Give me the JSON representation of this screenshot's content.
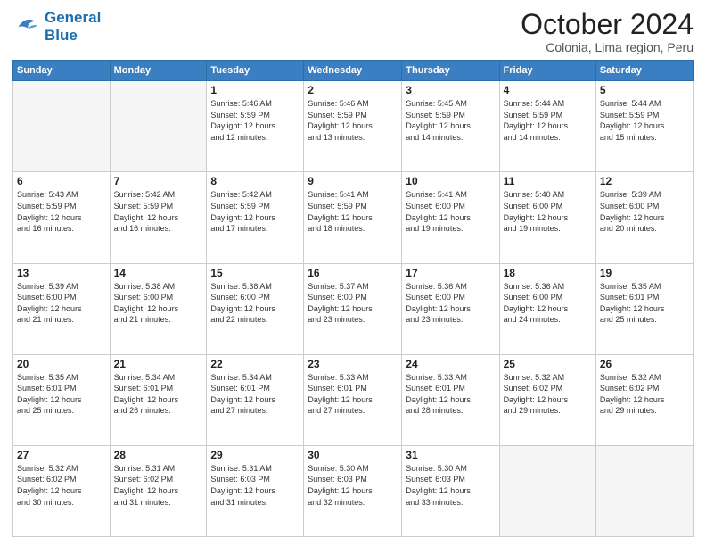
{
  "logo": {
    "line1": "General",
    "line2": "Blue"
  },
  "header": {
    "month": "October 2024",
    "location": "Colonia, Lima region, Peru"
  },
  "weekdays": [
    "Sunday",
    "Monday",
    "Tuesday",
    "Wednesday",
    "Thursday",
    "Friday",
    "Saturday"
  ],
  "weeks": [
    [
      {
        "day": "",
        "info": ""
      },
      {
        "day": "",
        "info": ""
      },
      {
        "day": "1",
        "info": "Sunrise: 5:46 AM\nSunset: 5:59 PM\nDaylight: 12 hours\nand 12 minutes."
      },
      {
        "day": "2",
        "info": "Sunrise: 5:46 AM\nSunset: 5:59 PM\nDaylight: 12 hours\nand 13 minutes."
      },
      {
        "day": "3",
        "info": "Sunrise: 5:45 AM\nSunset: 5:59 PM\nDaylight: 12 hours\nand 14 minutes."
      },
      {
        "day": "4",
        "info": "Sunrise: 5:44 AM\nSunset: 5:59 PM\nDaylight: 12 hours\nand 14 minutes."
      },
      {
        "day": "5",
        "info": "Sunrise: 5:44 AM\nSunset: 5:59 PM\nDaylight: 12 hours\nand 15 minutes."
      }
    ],
    [
      {
        "day": "6",
        "info": "Sunrise: 5:43 AM\nSunset: 5:59 PM\nDaylight: 12 hours\nand 16 minutes."
      },
      {
        "day": "7",
        "info": "Sunrise: 5:42 AM\nSunset: 5:59 PM\nDaylight: 12 hours\nand 16 minutes."
      },
      {
        "day": "8",
        "info": "Sunrise: 5:42 AM\nSunset: 5:59 PM\nDaylight: 12 hours\nand 17 minutes."
      },
      {
        "day": "9",
        "info": "Sunrise: 5:41 AM\nSunset: 5:59 PM\nDaylight: 12 hours\nand 18 minutes."
      },
      {
        "day": "10",
        "info": "Sunrise: 5:41 AM\nSunset: 6:00 PM\nDaylight: 12 hours\nand 19 minutes."
      },
      {
        "day": "11",
        "info": "Sunrise: 5:40 AM\nSunset: 6:00 PM\nDaylight: 12 hours\nand 19 minutes."
      },
      {
        "day": "12",
        "info": "Sunrise: 5:39 AM\nSunset: 6:00 PM\nDaylight: 12 hours\nand 20 minutes."
      }
    ],
    [
      {
        "day": "13",
        "info": "Sunrise: 5:39 AM\nSunset: 6:00 PM\nDaylight: 12 hours\nand 21 minutes."
      },
      {
        "day": "14",
        "info": "Sunrise: 5:38 AM\nSunset: 6:00 PM\nDaylight: 12 hours\nand 21 minutes."
      },
      {
        "day": "15",
        "info": "Sunrise: 5:38 AM\nSunset: 6:00 PM\nDaylight: 12 hours\nand 22 minutes."
      },
      {
        "day": "16",
        "info": "Sunrise: 5:37 AM\nSunset: 6:00 PM\nDaylight: 12 hours\nand 23 minutes."
      },
      {
        "day": "17",
        "info": "Sunrise: 5:36 AM\nSunset: 6:00 PM\nDaylight: 12 hours\nand 23 minutes."
      },
      {
        "day": "18",
        "info": "Sunrise: 5:36 AM\nSunset: 6:00 PM\nDaylight: 12 hours\nand 24 minutes."
      },
      {
        "day": "19",
        "info": "Sunrise: 5:35 AM\nSunset: 6:01 PM\nDaylight: 12 hours\nand 25 minutes."
      }
    ],
    [
      {
        "day": "20",
        "info": "Sunrise: 5:35 AM\nSunset: 6:01 PM\nDaylight: 12 hours\nand 25 minutes."
      },
      {
        "day": "21",
        "info": "Sunrise: 5:34 AM\nSunset: 6:01 PM\nDaylight: 12 hours\nand 26 minutes."
      },
      {
        "day": "22",
        "info": "Sunrise: 5:34 AM\nSunset: 6:01 PM\nDaylight: 12 hours\nand 27 minutes."
      },
      {
        "day": "23",
        "info": "Sunrise: 5:33 AM\nSunset: 6:01 PM\nDaylight: 12 hours\nand 27 minutes."
      },
      {
        "day": "24",
        "info": "Sunrise: 5:33 AM\nSunset: 6:01 PM\nDaylight: 12 hours\nand 28 minutes."
      },
      {
        "day": "25",
        "info": "Sunrise: 5:32 AM\nSunset: 6:02 PM\nDaylight: 12 hours\nand 29 minutes."
      },
      {
        "day": "26",
        "info": "Sunrise: 5:32 AM\nSunset: 6:02 PM\nDaylight: 12 hours\nand 29 minutes."
      }
    ],
    [
      {
        "day": "27",
        "info": "Sunrise: 5:32 AM\nSunset: 6:02 PM\nDaylight: 12 hours\nand 30 minutes."
      },
      {
        "day": "28",
        "info": "Sunrise: 5:31 AM\nSunset: 6:02 PM\nDaylight: 12 hours\nand 31 minutes."
      },
      {
        "day": "29",
        "info": "Sunrise: 5:31 AM\nSunset: 6:03 PM\nDaylight: 12 hours\nand 31 minutes."
      },
      {
        "day": "30",
        "info": "Sunrise: 5:30 AM\nSunset: 6:03 PM\nDaylight: 12 hours\nand 32 minutes."
      },
      {
        "day": "31",
        "info": "Sunrise: 5:30 AM\nSunset: 6:03 PM\nDaylight: 12 hours\nand 33 minutes."
      },
      {
        "day": "",
        "info": ""
      },
      {
        "day": "",
        "info": ""
      }
    ]
  ]
}
